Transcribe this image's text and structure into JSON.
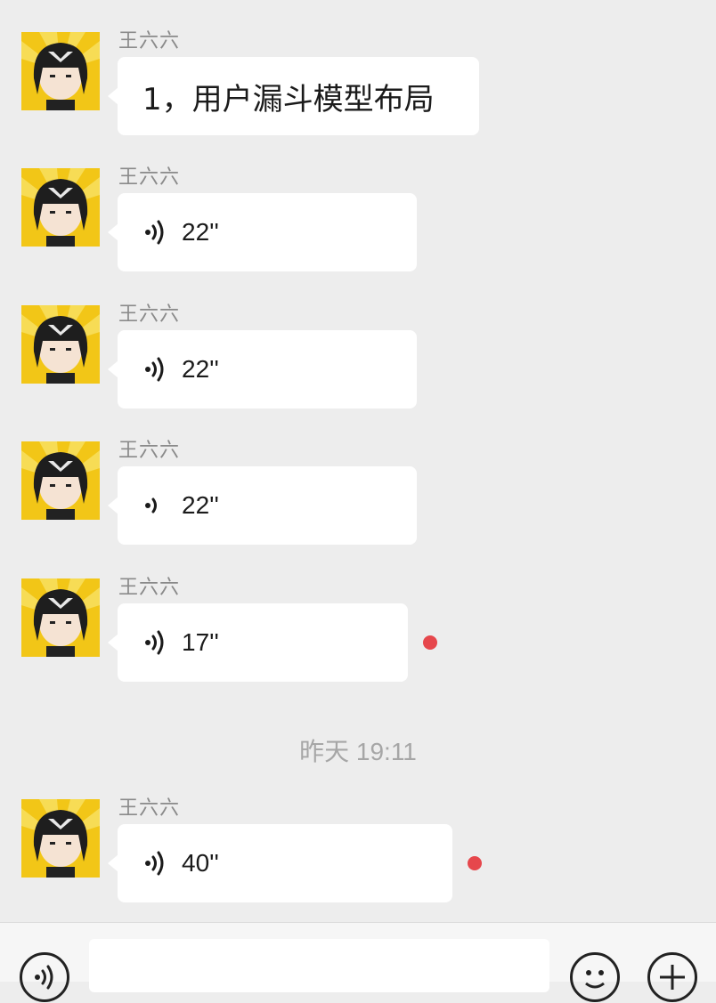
{
  "sender_name": "王六六",
  "messages": [
    {
      "type": "text",
      "text": "1，用户漏斗模型布局"
    },
    {
      "type": "voice",
      "duration": "22''",
      "unread": false
    },
    {
      "type": "voice",
      "duration": "22''",
      "unread": false
    },
    {
      "type": "voice",
      "duration": "22''",
      "unread": false
    },
    {
      "type": "voice",
      "duration": "17''",
      "unread": true
    },
    {
      "type": "voice",
      "duration": "40''",
      "unread": true
    }
  ],
  "timestamp": "昨天 19:11",
  "icons": {
    "voice_toggle": "voice-mode-icon",
    "emoji": "emoji-icon",
    "more": "plus-icon",
    "voice_message": "voice-wave-icon"
  },
  "colors": {
    "background": "#ededed",
    "bubble": "#ffffff",
    "unread_dot": "#e6474c",
    "avatar_bg": "#f2c617"
  }
}
